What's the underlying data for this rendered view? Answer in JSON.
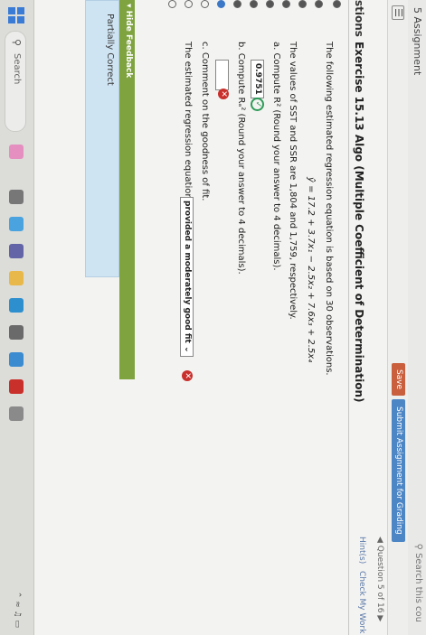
{
  "header": {
    "assignment_title": "5 Assignment",
    "search_text": "Search this cou",
    "save_label": "Save",
    "submit_label": "Submit Assignment for Grading",
    "question_counter": "Question 5 of 16",
    "hint_label": "Hint(s)",
    "check_label": "Check My Work"
  },
  "exercise": {
    "section_label": "stions",
    "title": "Exercise 15.13 Algo (Multiple Coefficient of Determination)"
  },
  "question": {
    "intro": "The following estimated regression equation is based on 30 observations.",
    "equation": "ŷ = 17.2 + 3.7x₁ − 2.5x₂ + 7.6x₃ + 2.5x₄",
    "values_text": "The values of SST and SSR are 1,804 and 1,759, respectively.",
    "part_a": "a. Compute R²  (Round your answer to 4 decimals).",
    "answer_a": "0.9751",
    "part_b": "b. Compute Rₐ²  (Round your answer to 4 decimals).",
    "answer_b": "",
    "part_c": "c. Comment on the goodness of fit.",
    "statement": "The estimated regression equation",
    "select_value": "provided a moderately good fit",
    "feedback_label": "▾ Hide Feedback",
    "feedback_status": "Partially Correct"
  },
  "taskbar": {
    "search_label": "Search"
  },
  "colors": {
    "save": "#c95f3c",
    "submit": "#4d86c5",
    "feedback_bar": "#7fa33f",
    "partial_box": "#cfe4f3",
    "correct": "#2e9b58",
    "incorrect": "#c9302c"
  }
}
